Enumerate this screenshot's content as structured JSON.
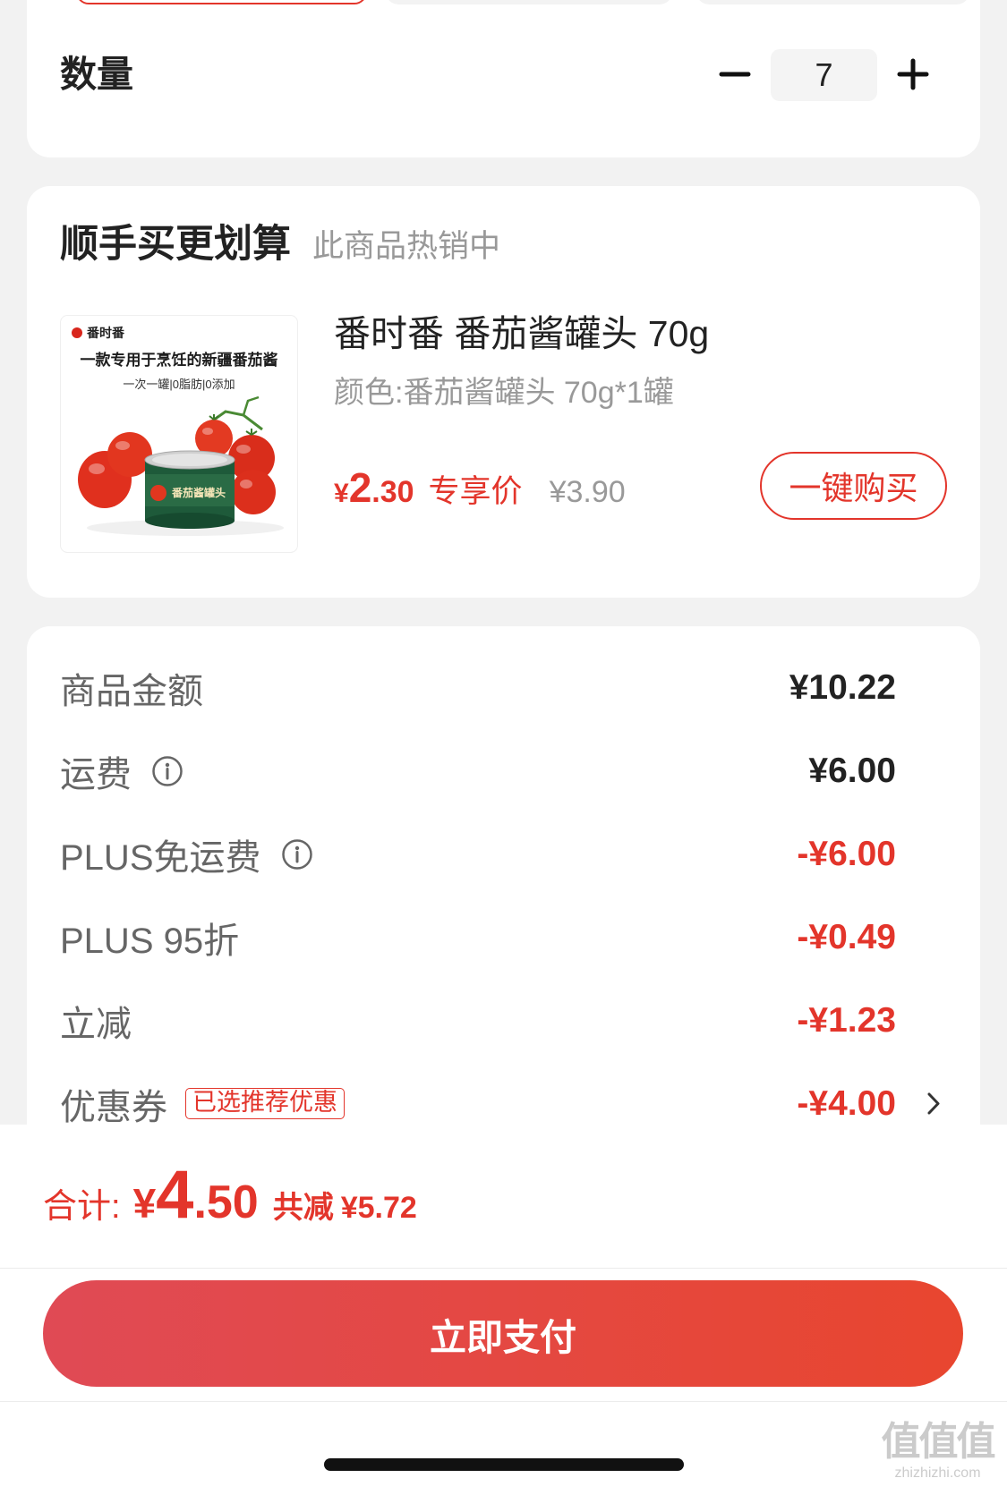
{
  "theme": {
    "accent": "#e3352b",
    "text": "#222222",
    "muted": "#999999",
    "label": "#666666",
    "background": "#f2f2f2"
  },
  "quantity": {
    "label": "数量",
    "value": "7",
    "decrement_icon": "minus-icon",
    "increment_icon": "plus-icon"
  },
  "recommend": {
    "title": "顺手买更划算",
    "subtitle": "此商品热销中",
    "product": {
      "image": {
        "brand": "番时番",
        "headline": "一款专用于烹饪的新疆番茄酱",
        "tagline": "一次一罐|0脂肪|0添加",
        "can_label": "番茄酱罐头"
      },
      "name": "番时番 番茄酱罐头 70g",
      "spec": "颜色:番茄酱罐头 70g*1罐",
      "price": {
        "currency": "¥",
        "integer": "2",
        "decimal": ".30"
      },
      "price_tag": "专享价",
      "original_price": "¥3.90",
      "buy_button": "一键购买"
    }
  },
  "summary": {
    "rows": [
      {
        "label": "商品金额",
        "value": "¥10.22",
        "discount": false,
        "info_icon": null
      },
      {
        "label": "运费",
        "value": "¥6.00",
        "discount": false,
        "info_icon": "info-icon"
      },
      {
        "label": "PLUS免运费",
        "value": "-¥6.00",
        "discount": true,
        "info_icon": "info-icon"
      },
      {
        "label": "PLUS 95折",
        "value": "-¥0.49",
        "discount": true,
        "info_icon": null
      },
      {
        "label": "立减",
        "value": "-¥1.23",
        "discount": true,
        "info_icon": null
      }
    ],
    "coupon": {
      "label": "优惠券",
      "tag": "已选推荐优惠",
      "value": "-¥4.00",
      "discount": true,
      "chevron_icon": "chevron-right-icon"
    }
  },
  "footer": {
    "total_label": "合计:",
    "total": {
      "currency": "¥",
      "integer": "4",
      "decimal": ".50"
    },
    "saved_label": "共减",
    "saved": "¥5.72",
    "pay_button": "立即支付"
  },
  "watermark": {
    "logo": "值值值",
    "domain": "zhizhizhi.com"
  }
}
